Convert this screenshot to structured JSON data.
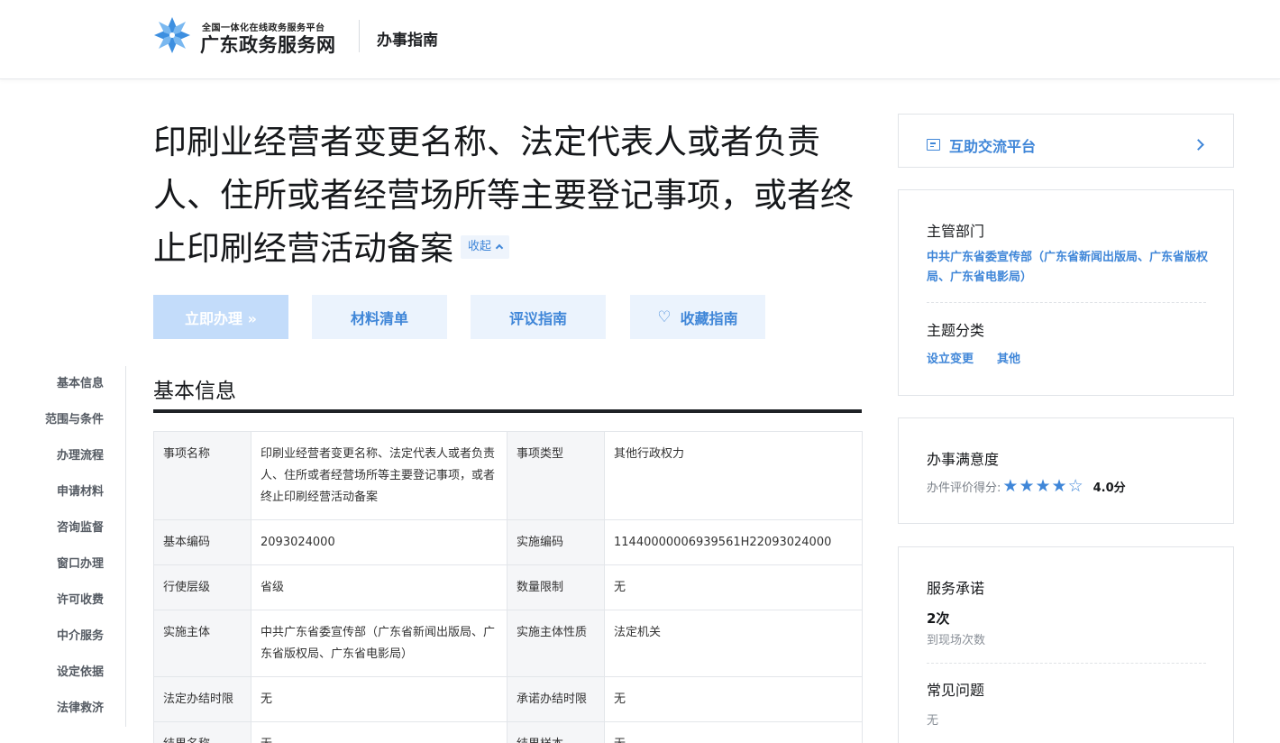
{
  "header": {
    "platform_sub": "全国一体化在线政务服务平台",
    "brand": "广东政务服务网",
    "nav_title": "办事指南"
  },
  "item": {
    "title": "印刷业经营者变更名称、法定代表人或者负责人、住所或者经营场所等主要登记事项，或者终止印刷经营活动备案",
    "collapse_label": "收起"
  },
  "actions": {
    "apply": "立即办理 »",
    "materials": "材料清单",
    "review": "评议指南",
    "favorite": "收藏指南"
  },
  "sidenav": [
    "基本信息",
    "范围与条件",
    "办理流程",
    "申请材料",
    "咨询监督",
    "窗口办理",
    "许可收费",
    "中介服务",
    "设定依据",
    "法律救济"
  ],
  "section": {
    "title": "基本信息"
  },
  "table": {
    "rows": [
      [
        "事项名称",
        "印刷业经营者变更名称、法定代表人或者负责人、住所或者经营场所等主要登记事项，或者终止印刷经营活动备案",
        "事项类型",
        "其他行政权力"
      ],
      [
        "基本编码",
        "2093024000",
        "实施编码",
        "11440000006939561H22093024000"
      ],
      [
        "行使层级",
        "省级",
        "数量限制",
        "无"
      ],
      [
        "实施主体",
        "中共广东省委宣传部（广东省新闻出版局、广东省版权局、广东省电影局）",
        "实施主体性质",
        "法定机关"
      ],
      [
        "法定办结时限",
        "无",
        "承诺办结时限",
        "无"
      ],
      [
        "结果名称",
        "无",
        "结果样本",
        "无"
      ]
    ]
  },
  "sidebar": {
    "forum_label": "互助交流平台",
    "dept_label": "主管部门",
    "dept_value": "中共广东省委宣传部（广东省新闻出版局、广东省版权局、广东省电影局）",
    "topic_label": "主题分类",
    "topics": [
      "设立变更",
      "其他"
    ],
    "satisfaction_label": "办事满意度",
    "rating_label": "办件评价得分:",
    "rating_stars": 4,
    "rating_max": 5,
    "rating_text": "4.0分",
    "commit_label": "服务承诺",
    "commit_count": "2次",
    "commit_sub": "到现场次数",
    "faq_label": "常见问题",
    "faq_value": "无"
  },
  "colors": {
    "accent": "#3f86d8",
    "primary_disabled": "#c3dcfa",
    "ghost_bg": "#ebf3fd"
  }
}
